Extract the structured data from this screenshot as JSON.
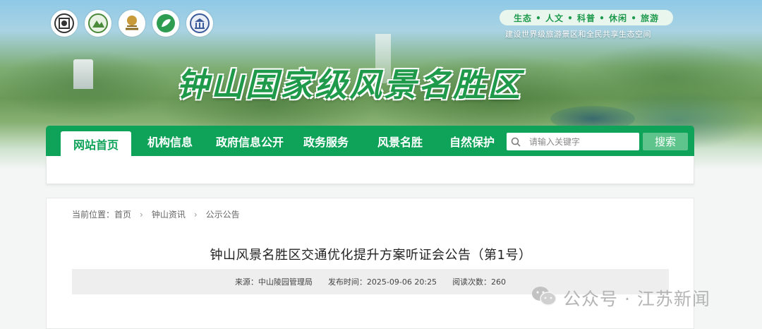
{
  "banner": {
    "logos": [
      "heritage-logo",
      "national-park-logo",
      "5a-scenic-logo",
      "ecology-logo",
      "museum-logo"
    ],
    "slogan": "生态 • 人文 • 科普 • 休闲 • 旅游",
    "slogan_sub": "建设世界级旅游景区和全民共享生态空间",
    "site_title": "钟山国家级风景名胜区"
  },
  "nav": {
    "items": [
      {
        "label": "网站首页",
        "active": true
      },
      {
        "label": "机构信息",
        "active": false
      },
      {
        "label": "政府信息公开",
        "active": false
      },
      {
        "label": "政务服务",
        "active": false
      },
      {
        "label": "风景名胜",
        "active": false
      },
      {
        "label": "自然保护",
        "active": false
      }
    ],
    "search_placeholder": "请输入关键字",
    "search_button": "搜索"
  },
  "breadcrumb": {
    "prefix": "当前位置：",
    "items": [
      "首页",
      "钟山资讯",
      "公示公告"
    ]
  },
  "article": {
    "title": "钟山风景名胜区交通优化提升方案听证会公告（第1号）",
    "source": "来源：中山陵园管理局",
    "publish_time": "发布时间：2025-09-06 20:25",
    "read_count": "阅读次数：260"
  },
  "watermark": {
    "text": "公众号 · 江苏新闻"
  },
  "colors": {
    "brand_green": "#0fa35a",
    "search_button": "#5ec48b",
    "title_green": "#1f9a4a"
  }
}
